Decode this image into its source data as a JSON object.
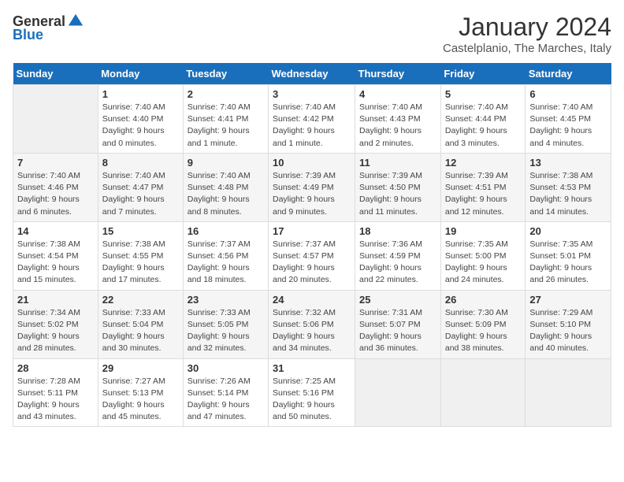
{
  "logo": {
    "general": "General",
    "blue": "Blue"
  },
  "header": {
    "title": "January 2024",
    "subtitle": "Castelplanio, The Marches, Italy"
  },
  "weekdays": [
    "Sunday",
    "Monday",
    "Tuesday",
    "Wednesday",
    "Thursday",
    "Friday",
    "Saturday"
  ],
  "weeks": [
    [
      {
        "day": "",
        "info": ""
      },
      {
        "day": "1",
        "info": "Sunrise: 7:40 AM\nSunset: 4:40 PM\nDaylight: 9 hours\nand 0 minutes."
      },
      {
        "day": "2",
        "info": "Sunrise: 7:40 AM\nSunset: 4:41 PM\nDaylight: 9 hours\nand 1 minute."
      },
      {
        "day": "3",
        "info": "Sunrise: 7:40 AM\nSunset: 4:42 PM\nDaylight: 9 hours\nand 1 minute."
      },
      {
        "day": "4",
        "info": "Sunrise: 7:40 AM\nSunset: 4:43 PM\nDaylight: 9 hours\nand 2 minutes."
      },
      {
        "day": "5",
        "info": "Sunrise: 7:40 AM\nSunset: 4:44 PM\nDaylight: 9 hours\nand 3 minutes."
      },
      {
        "day": "6",
        "info": "Sunrise: 7:40 AM\nSunset: 4:45 PM\nDaylight: 9 hours\nand 4 minutes."
      }
    ],
    [
      {
        "day": "7",
        "info": "Sunrise: 7:40 AM\nSunset: 4:46 PM\nDaylight: 9 hours\nand 6 minutes."
      },
      {
        "day": "8",
        "info": "Sunrise: 7:40 AM\nSunset: 4:47 PM\nDaylight: 9 hours\nand 7 minutes."
      },
      {
        "day": "9",
        "info": "Sunrise: 7:40 AM\nSunset: 4:48 PM\nDaylight: 9 hours\nand 8 minutes."
      },
      {
        "day": "10",
        "info": "Sunrise: 7:39 AM\nSunset: 4:49 PM\nDaylight: 9 hours\nand 9 minutes."
      },
      {
        "day": "11",
        "info": "Sunrise: 7:39 AM\nSunset: 4:50 PM\nDaylight: 9 hours\nand 11 minutes."
      },
      {
        "day": "12",
        "info": "Sunrise: 7:39 AM\nSunset: 4:51 PM\nDaylight: 9 hours\nand 12 minutes."
      },
      {
        "day": "13",
        "info": "Sunrise: 7:38 AM\nSunset: 4:53 PM\nDaylight: 9 hours\nand 14 minutes."
      }
    ],
    [
      {
        "day": "14",
        "info": "Sunrise: 7:38 AM\nSunset: 4:54 PM\nDaylight: 9 hours\nand 15 minutes."
      },
      {
        "day": "15",
        "info": "Sunrise: 7:38 AM\nSunset: 4:55 PM\nDaylight: 9 hours\nand 17 minutes."
      },
      {
        "day": "16",
        "info": "Sunrise: 7:37 AM\nSunset: 4:56 PM\nDaylight: 9 hours\nand 18 minutes."
      },
      {
        "day": "17",
        "info": "Sunrise: 7:37 AM\nSunset: 4:57 PM\nDaylight: 9 hours\nand 20 minutes."
      },
      {
        "day": "18",
        "info": "Sunrise: 7:36 AM\nSunset: 4:59 PM\nDaylight: 9 hours\nand 22 minutes."
      },
      {
        "day": "19",
        "info": "Sunrise: 7:35 AM\nSunset: 5:00 PM\nDaylight: 9 hours\nand 24 minutes."
      },
      {
        "day": "20",
        "info": "Sunrise: 7:35 AM\nSunset: 5:01 PM\nDaylight: 9 hours\nand 26 minutes."
      }
    ],
    [
      {
        "day": "21",
        "info": "Sunrise: 7:34 AM\nSunset: 5:02 PM\nDaylight: 9 hours\nand 28 minutes."
      },
      {
        "day": "22",
        "info": "Sunrise: 7:33 AM\nSunset: 5:04 PM\nDaylight: 9 hours\nand 30 minutes."
      },
      {
        "day": "23",
        "info": "Sunrise: 7:33 AM\nSunset: 5:05 PM\nDaylight: 9 hours\nand 32 minutes."
      },
      {
        "day": "24",
        "info": "Sunrise: 7:32 AM\nSunset: 5:06 PM\nDaylight: 9 hours\nand 34 minutes."
      },
      {
        "day": "25",
        "info": "Sunrise: 7:31 AM\nSunset: 5:07 PM\nDaylight: 9 hours\nand 36 minutes."
      },
      {
        "day": "26",
        "info": "Sunrise: 7:30 AM\nSunset: 5:09 PM\nDaylight: 9 hours\nand 38 minutes."
      },
      {
        "day": "27",
        "info": "Sunrise: 7:29 AM\nSunset: 5:10 PM\nDaylight: 9 hours\nand 40 minutes."
      }
    ],
    [
      {
        "day": "28",
        "info": "Sunrise: 7:28 AM\nSunset: 5:11 PM\nDaylight: 9 hours\nand 43 minutes."
      },
      {
        "day": "29",
        "info": "Sunrise: 7:27 AM\nSunset: 5:13 PM\nDaylight: 9 hours\nand 45 minutes."
      },
      {
        "day": "30",
        "info": "Sunrise: 7:26 AM\nSunset: 5:14 PM\nDaylight: 9 hours\nand 47 minutes."
      },
      {
        "day": "31",
        "info": "Sunrise: 7:25 AM\nSunset: 5:16 PM\nDaylight: 9 hours\nand 50 minutes."
      },
      {
        "day": "",
        "info": ""
      },
      {
        "day": "",
        "info": ""
      },
      {
        "day": "",
        "info": ""
      }
    ]
  ]
}
